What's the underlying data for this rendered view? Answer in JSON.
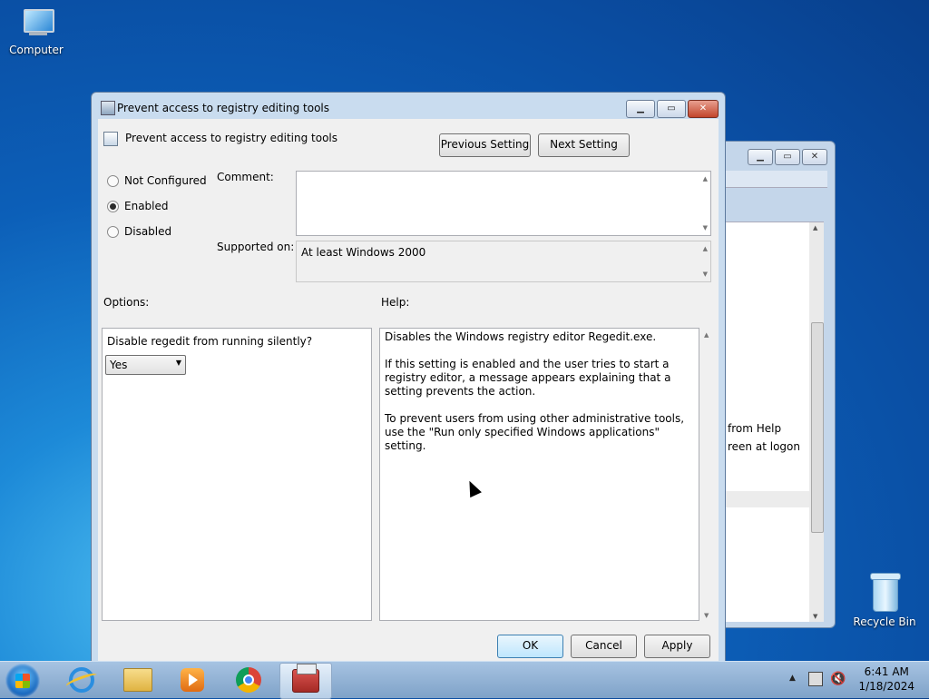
{
  "desktop": {
    "icons": [
      {
        "label": "Computer"
      },
      {
        "label": "Recycle Bin"
      }
    ]
  },
  "background_window": {
    "text_line1": "from Help",
    "text_line2": "reen at logon"
  },
  "dialog": {
    "window_title": "Prevent access to registry editing tools",
    "policy_name": "Prevent access to registry editing tools",
    "previous_button": "Previous Setting",
    "next_button": "Next Setting",
    "state_options": [
      {
        "label": "Not Configured",
        "selected": false
      },
      {
        "label": "Enabled",
        "selected": true
      },
      {
        "label": "Disabled",
        "selected": false
      }
    ],
    "comment_label": "Comment:",
    "comment_value": "",
    "supported_label": "Supported on:",
    "supported_value": "At least Windows 2000",
    "options_label": "Options:",
    "help_label": "Help:",
    "option_question": "Disable regedit from running silently?",
    "option_select_value": "Yes",
    "help_paragraphs": [
      "Disables the Windows registry editor Regedit.exe.",
      "If this setting is enabled and the user tries to start a registry editor, a message appears explaining that a setting prevents the action.",
      "To prevent users from using other administrative tools, use the \"Run only specified Windows applications\" setting."
    ],
    "ok_button": "OK",
    "cancel_button": "Cancel",
    "apply_button": "Apply"
  },
  "taskbar": {
    "pinned": [
      "internet-explorer",
      "file-explorer",
      "media-player",
      "chrome",
      "group-policy-editor"
    ],
    "clock_time": "6:41 AM",
    "clock_date": "1/18/2024"
  },
  "colors": {
    "desktop_blue": "#0c5fb8",
    "dialog_frame": "#c9dcef",
    "close_red": "#c2452c"
  }
}
